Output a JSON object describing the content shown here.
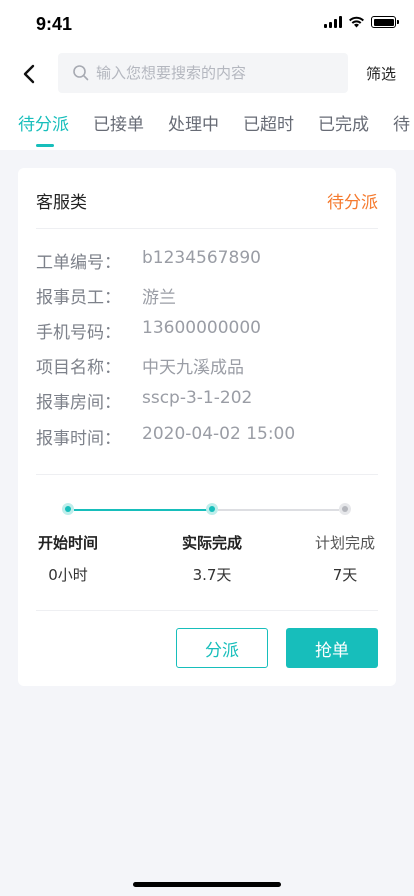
{
  "status_bar": {
    "time": "9:41"
  },
  "search": {
    "placeholder": "输入您想要搜索的内容",
    "value": ""
  },
  "nav": {
    "filter_label": "筛选"
  },
  "tabs": [
    {
      "label": "待分派",
      "active": true
    },
    {
      "label": "已接单",
      "active": false
    },
    {
      "label": "处理中",
      "active": false
    },
    {
      "label": "已超时",
      "active": false
    },
    {
      "label": "已完成",
      "active": false
    },
    {
      "label": "待",
      "active": false
    }
  ],
  "card": {
    "type": "客服类",
    "status": "待分派",
    "fields": [
      {
        "label": "工单编号：",
        "value": "b1234567890"
      },
      {
        "label": "报事员工：",
        "value": "游兰"
      },
      {
        "label": "手机号码：",
        "value": "13600000000"
      },
      {
        "label": "项目名称：",
        "value": "中天九溪成品"
      },
      {
        "label": "报事房间：",
        "value": "sscp-3-1-202"
      },
      {
        "label": "报事时间：",
        "value": "2020-04-02 15:00"
      }
    ],
    "progress": {
      "completed_steps": 2,
      "stages": [
        {
          "title": "开始时间",
          "value": "0小时",
          "bold": true
        },
        {
          "title": "实际完成",
          "value": "3.7天",
          "bold": true
        },
        {
          "title": "计划完成",
          "value": "7天",
          "bold": false
        }
      ]
    },
    "actions": {
      "assign_label": "分派",
      "grab_label": "抢单"
    }
  },
  "colors": {
    "accent": "#17BEBB",
    "status_pending": "#F57A2E",
    "background": "#F4F5F9"
  }
}
